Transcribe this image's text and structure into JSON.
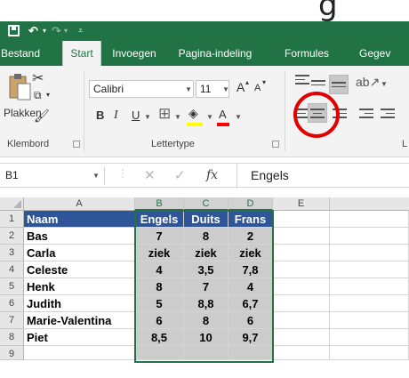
{
  "caption_fragment": "g",
  "tabs": [
    "Bestand",
    "Start",
    "Invoegen",
    "Pagina-indeling",
    "Formules",
    "Gegev"
  ],
  "active_tab": "Start",
  "ribbon": {
    "clipboard_group_label": "Klembord",
    "paste_label": "Plakken",
    "font_group_label": "Lettertype",
    "font_name": "Calibri",
    "font_size": "11",
    "grow_font": "A",
    "shrink_font": "A",
    "bold": "B",
    "italic": "I",
    "underline": "U",
    "font_color_letter": "A",
    "alignment_group_label": "L"
  },
  "formula_bar": {
    "name_box": "B1",
    "fx_label": "fx",
    "content": "Engels"
  },
  "sheet": {
    "columns": [
      "A",
      "B",
      "C",
      "D",
      "E"
    ],
    "row_numbers": [
      "1",
      "2",
      "3",
      "4",
      "5",
      "6",
      "7",
      "8",
      "9"
    ],
    "header": [
      "Naam",
      "Engels",
      "Duits",
      "Frans"
    ],
    "rows": [
      [
        "Bas",
        "7",
        "8",
        "2"
      ],
      [
        "Carla",
        "ziek",
        "ziek",
        "ziek"
      ],
      [
        "Celeste",
        "4",
        "3,5",
        "7,8"
      ],
      [
        "Henk",
        "8",
        "7",
        "4"
      ],
      [
        "Judith",
        "5",
        "8,8",
        "6,7"
      ],
      [
        "Marie-Valentina",
        "6",
        "8",
        "6"
      ],
      [
        "Piet",
        "8,5",
        "10",
        "9,7"
      ]
    ],
    "selected_range": "B1:D9",
    "header_color": "#2E5597",
    "selection_color": "#217346"
  },
  "colors": {
    "ribbon_green": "#217346",
    "highlight_circle": "#E00000"
  }
}
